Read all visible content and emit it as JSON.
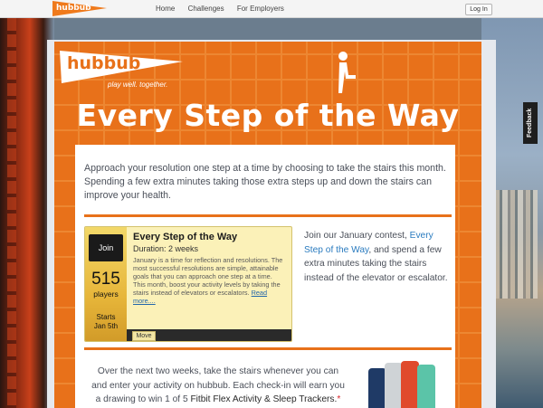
{
  "header": {
    "brand": "hubbub",
    "nav": [
      "Home",
      "Challenges",
      "For Employers"
    ],
    "login_label": "Log In"
  },
  "banner": {
    "logo_text": "hubbub",
    "registered": "®",
    "tagline": "play well. together.",
    "title": "Every Step of the Way"
  },
  "content": {
    "intro": "Approach your resolution one step at a time by choosing to take the stairs this month. Spending a few extra minutes taking those extra steps up and down the stairs can improve your health.",
    "side_prefix": "Join our January contest, ",
    "side_link": "Every Step of the Way",
    "side_suffix": ", and spend a few extra minutes taking the stairs instead of the elevator or escalator.",
    "bottom_a": "Over the next two weeks, take the stairs whenever you can and enter your activity on hubbub. Each check-in will earn you a drawing to win 1 of 5 ",
    "bottom_highlight": "Fitbit Flex Activity & Sleep Trackers.",
    "bottom_star": "*"
  },
  "challenge": {
    "join_label": "Join",
    "players_count": "515",
    "players_label": "players",
    "starts_label": "Starts",
    "starts_date": "Jan 5th",
    "title": "Every Step of the Way",
    "duration": "Duration: 2 weeks",
    "description": "January is a time for reflection and resolutions. The most successful resolutions are simple, attainable goals that you can approach one step at a time.",
    "description_2": "This month, boost your activity levels by taking the stairs instead of elevators or escalators.",
    "read_more": "Read more....",
    "move_label": "Move"
  },
  "feedback_label": "Feedback",
  "colors": {
    "orange": "#e8711a",
    "link": "#2a7bbf",
    "panel_card": "#fbf1b8"
  }
}
